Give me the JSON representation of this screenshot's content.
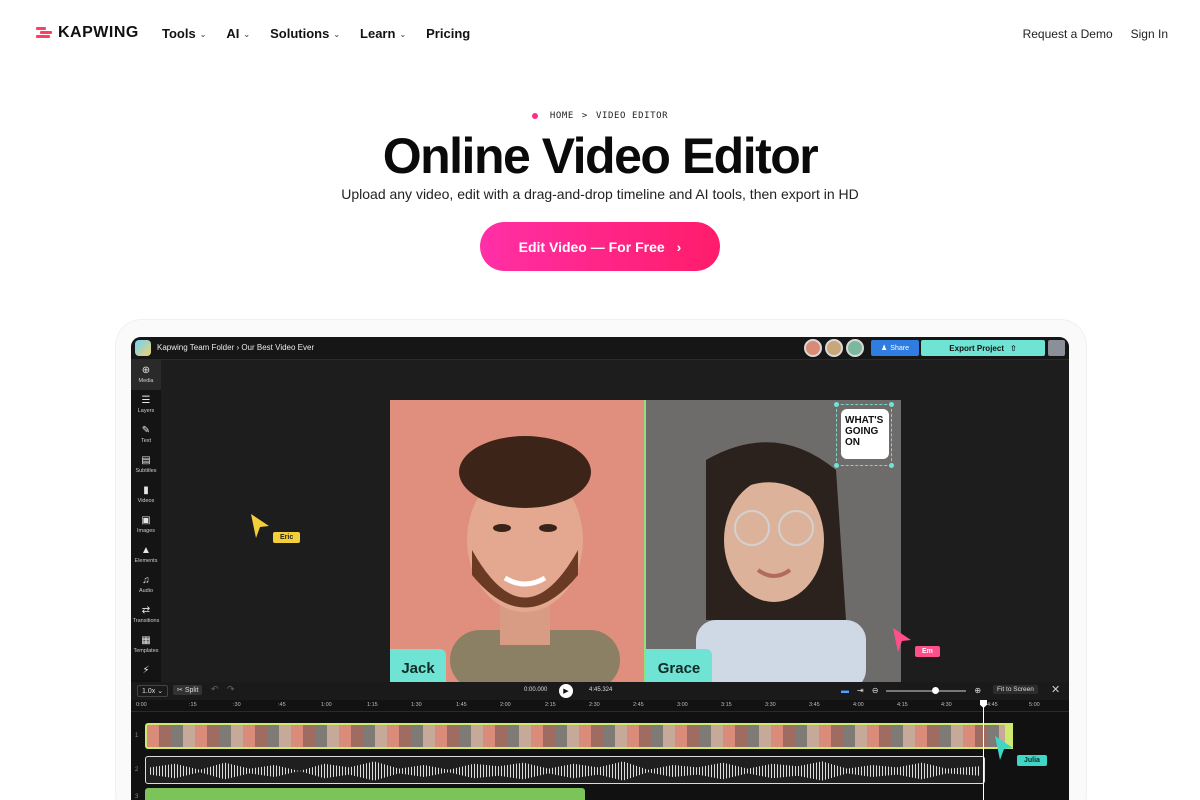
{
  "brand": {
    "name": "KAPWING",
    "accent": "#ff2d8a"
  },
  "nav": {
    "items": [
      {
        "label": "Tools",
        "has_menu": true
      },
      {
        "label": "AI",
        "has_menu": true
      },
      {
        "label": "Solutions",
        "has_menu": true
      },
      {
        "label": "Learn",
        "has_menu": true
      },
      {
        "label": "Pricing",
        "has_menu": false
      }
    ],
    "request_demo": "Request a Demo",
    "sign_in": "Sign In"
  },
  "hero": {
    "breadcrumb_home": "HOME",
    "breadcrumb_sep": ">",
    "breadcrumb_current": "VIDEO EDITOR",
    "title": "Online Video Editor",
    "subtitle": "Upload any video, edit with a drag-and-drop timeline and AI tools, then export in HD",
    "cta": "Edit Video — For Free"
  },
  "editor": {
    "path": "Kapwing Team Folder › Our Best Video Ever",
    "share": "Share",
    "export": "Export Project",
    "sidebar": [
      "Media",
      "Layers",
      "Text",
      "Subtitles",
      "Videos",
      "Images",
      "Elements",
      "Audio",
      "Transitions",
      "Templates"
    ],
    "sidebar_active": "Media",
    "people": {
      "left": "Jack",
      "right": "Grace"
    },
    "sticker": "WHAT'S GOING ON",
    "cursors": [
      {
        "name": "Eric",
        "color": "#f4cf3b"
      },
      {
        "name": "Em",
        "color": "#ff4f8b"
      },
      {
        "name": "Julia",
        "color": "#3fd6c6"
      }
    ],
    "timeline": {
      "speed": "1.0x",
      "split": "Split",
      "current_time": "0:00.000",
      "total_time": "4:45.324",
      "fit": "Fit to Screen",
      "ticks": [
        "0:00",
        ":15",
        ":30",
        ":45",
        "1:00",
        "1:15",
        "1:30",
        "1:45",
        "2:00",
        "2:15",
        "2:30",
        "2:45",
        "3:00",
        "3:15",
        "3:30",
        "3:45",
        "4:00",
        "4:15",
        "4:30",
        "4:45",
        "5:00"
      ],
      "tracks": [
        "1",
        "2",
        "3"
      ]
    }
  }
}
